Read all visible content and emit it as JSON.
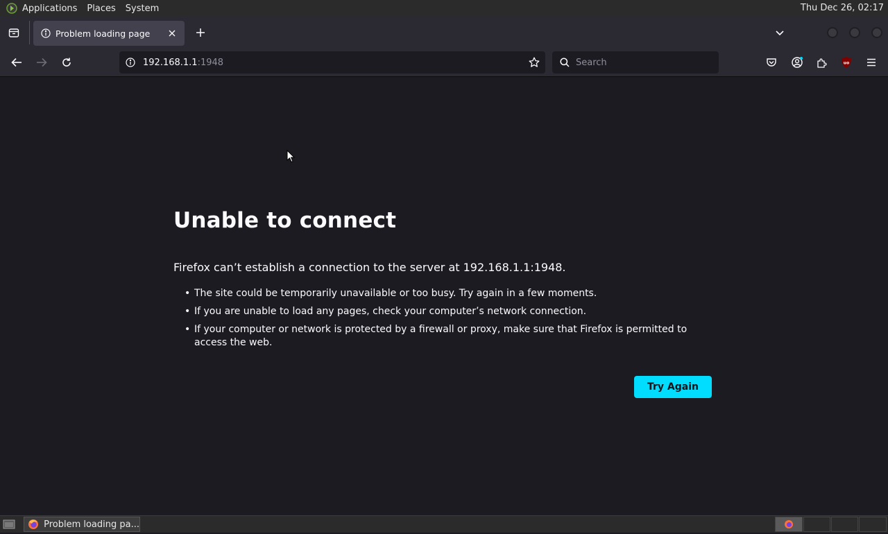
{
  "top_panel": {
    "menus": [
      "Applications",
      "Places",
      "System"
    ],
    "clock": "Thu Dec 26, 02:17"
  },
  "tabs": [
    {
      "title": "Problem loading page",
      "icon": "info-icon"
    }
  ],
  "navbar": {
    "url_host": "192.168.1.1",
    "url_port": ":1948",
    "search_placeholder": "Search"
  },
  "error_page": {
    "title": "Unable to connect",
    "description": "Firefox can’t establish a connection to the server at 192.168.1.1:1948.",
    "bullets": [
      "The site could be temporarily unavailable or too busy. Try again in a few moments.",
      "If you are unable to load any pages, check your computer’s network connection.",
      "If your computer or network is protected by a firewall or proxy, make sure that Firefox is permitted to access the web."
    ],
    "button": "Try Again"
  },
  "taskbar": {
    "window_label": "Problem loading pa..."
  },
  "colors": {
    "accent": "#00ddff",
    "page_bg": "#1c1b22",
    "toolbar_bg": "#2b2a33"
  }
}
